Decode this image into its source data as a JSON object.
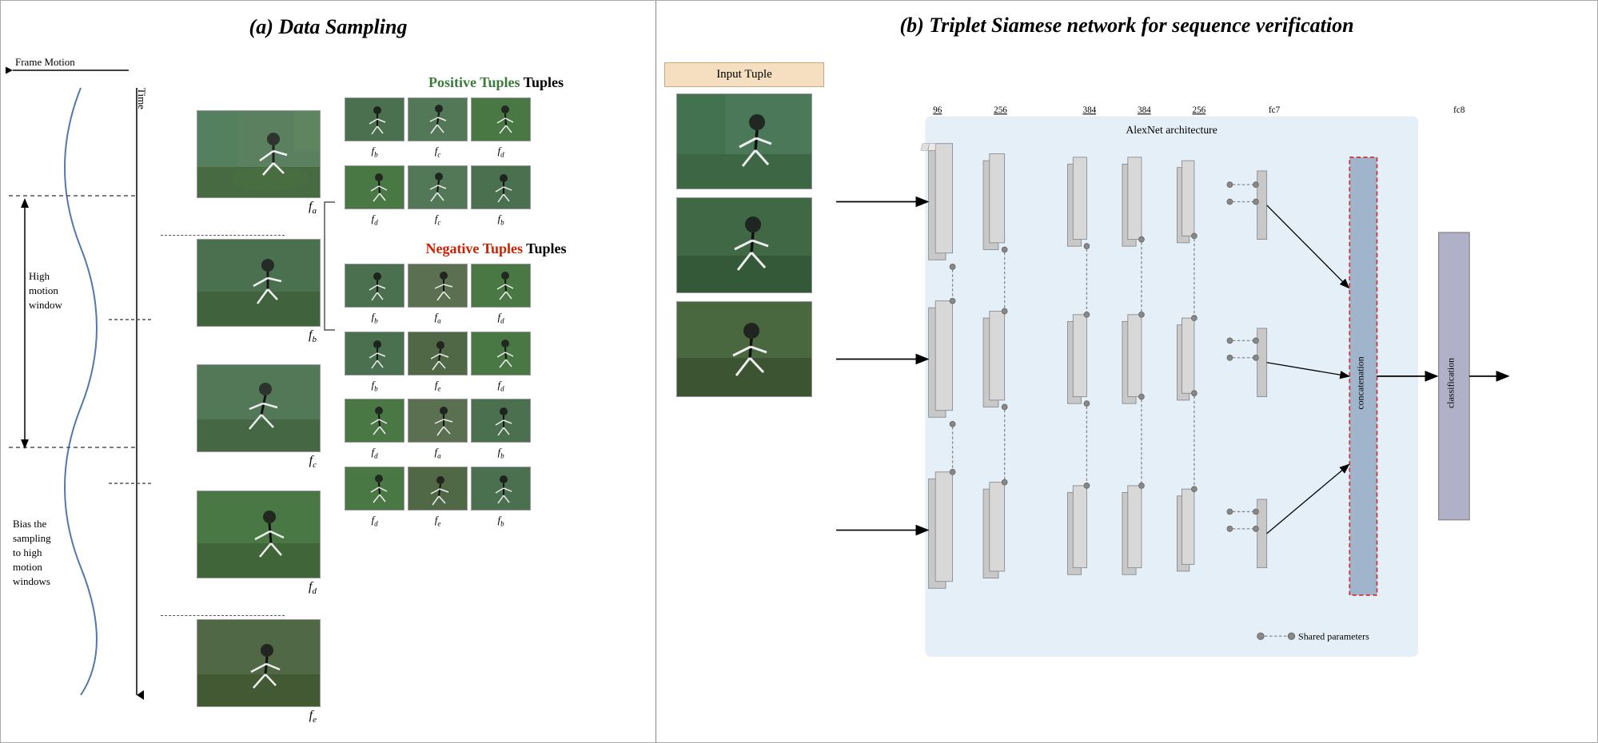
{
  "left_panel": {
    "title": "(a) Data Sampling",
    "frame_motion": "Frame Motion",
    "time_label": "Time",
    "high_motion_window": "High\nmotion\nwindow",
    "bias_sampling": "Bias the\nsampling\nto high\nmotion\nwindows",
    "frames": [
      {
        "id": "fa",
        "label": "f",
        "sub": "a"
      },
      {
        "id": "fb",
        "label": "f",
        "sub": "b"
      },
      {
        "id": "fc",
        "label": "f",
        "sub": "c"
      },
      {
        "id": "fd",
        "label": "f",
        "sub": "d"
      },
      {
        "id": "fe",
        "label": "f",
        "sub": "e"
      }
    ],
    "positive_tuples": {
      "label": "Positive Tuples",
      "rows": [
        {
          "imgs": [
            "tb",
            "tc",
            "td"
          ],
          "labels": [
            "f_b",
            "f_c",
            "f_d"
          ]
        },
        {
          "imgs": [
            "td",
            "tc",
            "tb"
          ],
          "labels": [
            "f_d",
            "f_c",
            "f_b"
          ]
        }
      ]
    },
    "negative_tuples": {
      "label": "Negative Tuples",
      "rows": [
        {
          "imgs": [
            "tb",
            "ta",
            "td"
          ],
          "labels": [
            "f_b",
            "f_a",
            "f_d"
          ]
        },
        {
          "imgs": [
            "tb",
            "te",
            "td"
          ],
          "labels": [
            "f_b",
            "f_e",
            "f_d"
          ]
        },
        {
          "imgs": [
            "td",
            "ta",
            "tb"
          ],
          "labels": [
            "f_d",
            "f_a",
            "f_b"
          ]
        },
        {
          "imgs": [
            "td",
            "te",
            "tb"
          ],
          "labels": [
            "f_d",
            "f_e",
            "f_b"
          ]
        }
      ]
    }
  },
  "right_panel": {
    "title": "(b) Triplet Siamese network for sequence\nverification",
    "input_tuple_label": "Input Tuple",
    "alexnet_label": "AlexNet architecture",
    "layer_sizes": [
      "96",
      "256",
      "384",
      "384",
      "256"
    ],
    "fc7_label": "fc7",
    "fc8_label": "fc8",
    "concatenation_label": "concatenation",
    "classification_label": "classification",
    "shared_params_label": "Shared parameters"
  }
}
